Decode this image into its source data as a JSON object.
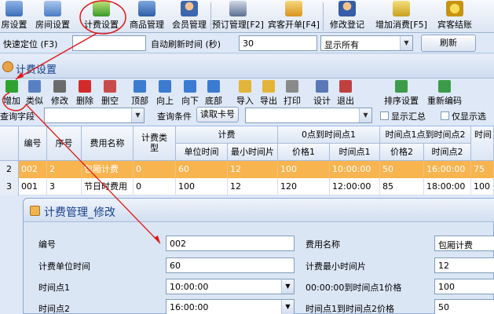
{
  "main_toolbar": {
    "buttons": [
      {
        "label": "房设置"
      },
      {
        "label": "房间设置"
      },
      {
        "label": "计费设置"
      },
      {
        "label": "商品管理"
      },
      {
        "label": "会员管理"
      },
      {
        "label": "预订管理[F2]"
      },
      {
        "label": "宾客开单[F4]"
      },
      {
        "label": "修改登记"
      },
      {
        "label": "增加消费[F5]"
      },
      {
        "label": "宾客结账"
      }
    ]
  },
  "quick_bar": {
    "locate_label": "快速定位 (F3)",
    "locate_value": "",
    "refresh_label": "自动刷新时间 (秒)",
    "refresh_value": "30",
    "display_option": "显示所有",
    "refresh_button": "刷新"
  },
  "window": {
    "title": "计费设置"
  },
  "sub_toolbar": {
    "buttons": [
      {
        "label": "增加"
      },
      {
        "label": "类似"
      },
      {
        "label": "修改"
      },
      {
        "label": "删除"
      },
      {
        "label": "删空"
      },
      {
        "label": "顶部"
      },
      {
        "label": "向上"
      },
      {
        "label": "向下"
      },
      {
        "label": "底部"
      },
      {
        "label": "导入"
      },
      {
        "label": "导出"
      },
      {
        "label": "打印"
      },
      {
        "label": "设计"
      },
      {
        "label": "退出"
      },
      {
        "label": "排序设置"
      },
      {
        "label": "重新编码"
      }
    ]
  },
  "query": {
    "field_label": "查询字段",
    "condition_label": "查询条件",
    "read_card_button": "读取卡号",
    "show_summary_label": "显示汇总",
    "show_only_label": "仅显示选"
  },
  "grid": {
    "headers": {
      "code": "编号",
      "seq": "序号",
      "name": "费用名称",
      "type": "计费类型",
      "billing": "计费",
      "unit_time": "单位时间",
      "min_slice": "最小时间片",
      "range1": "0点到时间点1",
      "price1": "价格1",
      "time1": "时间点1",
      "range2": "时间点1点到时间点2",
      "price2": "价格2",
      "time2": "时间点2",
      "range3": "时间"
    },
    "rows": [
      {
        "num": "2",
        "code": "002",
        "seq": "2",
        "name": "包厢计费",
        "type": "0",
        "unit_time": "60",
        "min_slice": "12",
        "price1": "100",
        "time1": "10:00:00",
        "price2": "50",
        "time2": "16:00:00",
        "extra": "75"
      },
      {
        "num": "3",
        "code": "001",
        "seq": "3",
        "name": "节日时费用",
        "type": "0",
        "unit_time": "100",
        "min_slice": "12",
        "price1": "120",
        "time1": "12:00:00",
        "price2": "85",
        "time2": "18:00:00",
        "extra": "100"
      }
    ]
  },
  "dialog": {
    "title": "计费管理_修改",
    "fields": {
      "code_label": "编号",
      "code_value": "002",
      "name_label": "费用名称",
      "name_value": "包厢计费",
      "unit_label": "计费单位时间",
      "unit_value": "60",
      "min_label": "计费最小时间片",
      "min_value": "12",
      "t1_label": "时间点1",
      "t1_value": "10:00:00",
      "p1_label": "00:00:00到时间点1价格",
      "p1_value": "100",
      "t2_label": "时间点2",
      "t2_value": "16:00:00",
      "p2_label": "时间点1到时间点2价格",
      "p2_value": "50"
    }
  },
  "colors": {
    "selected_row": "#f7b44f",
    "annotation": "#e01818",
    "title_text": "#15428b"
  }
}
